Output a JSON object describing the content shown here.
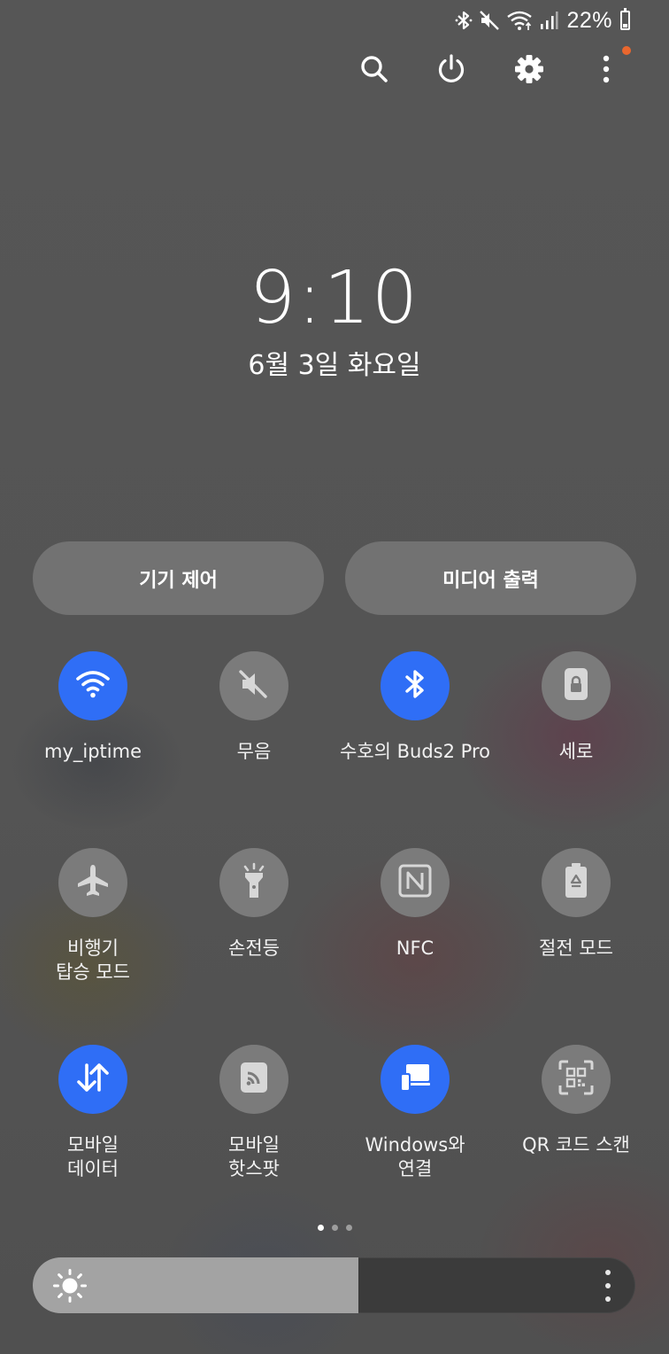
{
  "status_bar": {
    "icons": [
      "bluetooth-icon",
      "mute-icon",
      "wifi-icon",
      "signal-icon"
    ],
    "battery_percent": "22%"
  },
  "top_actions": [
    "search-icon",
    "power-icon",
    "settings-icon",
    "more-options-icon"
  ],
  "clock": {
    "time": "9:10",
    "date": "6월 3일 화요일"
  },
  "panels": {
    "device_control": "기기 제어",
    "media_output": "미디어 출력"
  },
  "tiles": [
    {
      "label": "my_iptime",
      "icon": "wifi-icon",
      "active": true
    },
    {
      "label": "무음",
      "icon": "mute-icon",
      "active": false
    },
    {
      "label": "수호의 Buds2 Pro",
      "icon": "bluetooth-icon",
      "active": true
    },
    {
      "label": "세로",
      "icon": "portrait-lock-icon",
      "active": false
    },
    {
      "label": "비행기\n탑승 모드",
      "icon": "airplane-icon",
      "active": false
    },
    {
      "label": "손전등",
      "icon": "flashlight-icon",
      "active": false
    },
    {
      "label": "NFC",
      "icon": "nfc-icon",
      "active": false
    },
    {
      "label": "절전 모드",
      "icon": "power-saving-icon",
      "active": false
    },
    {
      "label": "모바일\n데이터",
      "icon": "mobile-data-icon",
      "active": true
    },
    {
      "label": "모바일\n핫스팟",
      "icon": "hotspot-icon",
      "active": false
    },
    {
      "label": "Windows와\n연결",
      "icon": "link-to-windows-icon",
      "active": true
    },
    {
      "label": "QR 코드 스캔",
      "icon": "qr-scan-icon",
      "active": false
    }
  ],
  "pager": {
    "pages": 3,
    "current": 1
  },
  "brightness": {
    "level": 0.54,
    "icon": "sun-icon"
  },
  "colors": {
    "accent": "#2f6ef6",
    "tile_off": "#7b7b7b",
    "notification_dot": "#e9672e"
  }
}
